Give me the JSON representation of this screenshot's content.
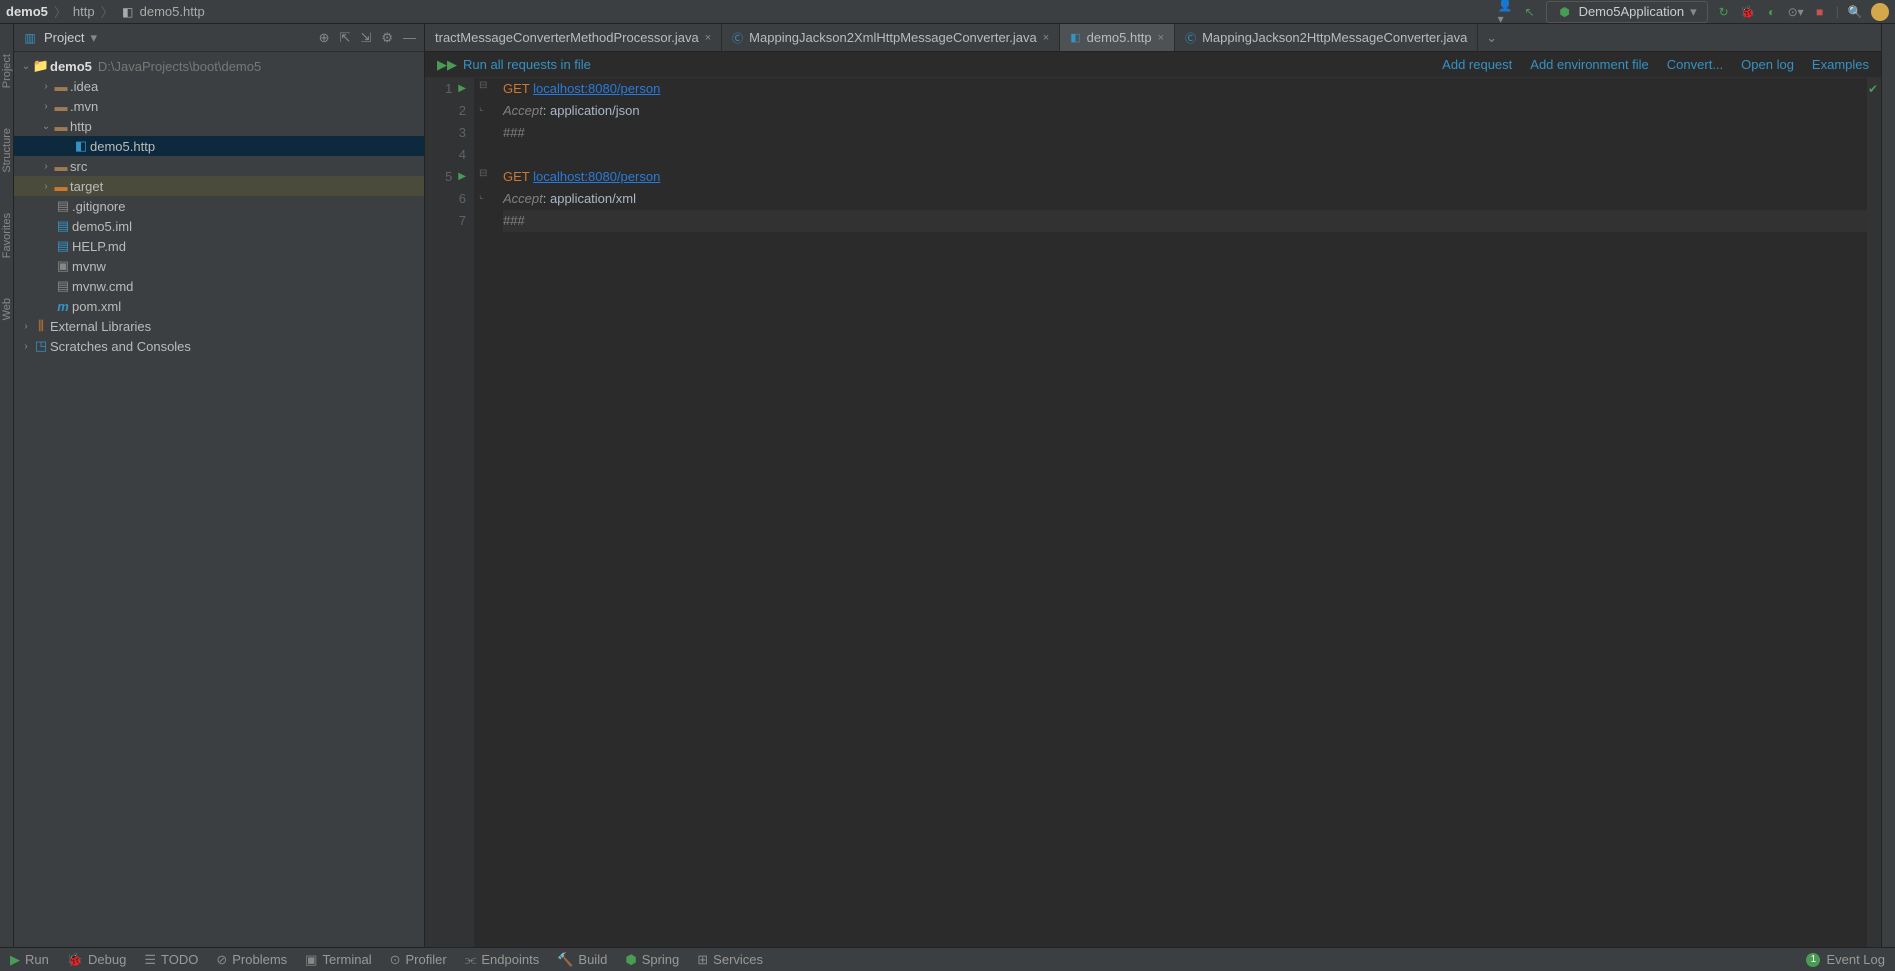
{
  "breadcrumb": {
    "root": "demo5",
    "mid": "http",
    "file": "demo5.http"
  },
  "run_config": {
    "label": "Demo5Application"
  },
  "left_gutter": {
    "project": "Project",
    "structure": "Structure",
    "favorites": "Favorites",
    "web": "Web"
  },
  "panel": {
    "title": "Project"
  },
  "tree": {
    "root": {
      "name": "demo5",
      "path": "D:\\JavaProjects\\boot\\demo5"
    },
    "idea": ".idea",
    "mvn": ".mvn",
    "http": "http",
    "http_file": "demo5.http",
    "src": "src",
    "target": "target",
    "gitignore": ".gitignore",
    "iml": "demo5.iml",
    "help": "HELP.md",
    "mvnw": "mvnw",
    "mvnwcmd": "mvnw.cmd",
    "pom": "pom.xml",
    "ext": "External Libraries",
    "scratch": "Scratches and Consoles"
  },
  "tabs": {
    "t1": "tractMessageConverterMethodProcessor.java",
    "t2": "MappingJackson2XmlHttpMessageConverter.java",
    "t3": "demo5.http",
    "t4": "MappingJackson2HttpMessageConverter.java"
  },
  "editor_toolbar": {
    "run_all": "Run all requests in file",
    "add_request": "Add request",
    "add_env": "Add environment file",
    "convert": "Convert...",
    "open_log": "Open log",
    "examples": "Examples"
  },
  "code": {
    "l1_method": "GET ",
    "l1_url": "localhost:8080/person",
    "l2_header": "Accept",
    "l2_sep": ": ",
    "l2_value": "application/json",
    "l3": "###",
    "l5_method": "GET ",
    "l5_url": "localhost:8080/person",
    "l6_header": "Accept",
    "l6_sep": ": ",
    "l6_value": "application/xml",
    "l7": "###"
  },
  "line_numbers": {
    "n1": "1",
    "n2": "2",
    "n3": "3",
    "n4": "4",
    "n5": "5",
    "n6": "6",
    "n7": "7"
  },
  "status": {
    "run": "Run",
    "debug": "Debug",
    "todo": "TODO",
    "problems": "Problems",
    "terminal": "Terminal",
    "profiler": "Profiler",
    "endpoints": "Endpoints",
    "build": "Build",
    "spring": "Spring",
    "services": "Services",
    "event_log": "Event Log",
    "event_count": "1"
  }
}
